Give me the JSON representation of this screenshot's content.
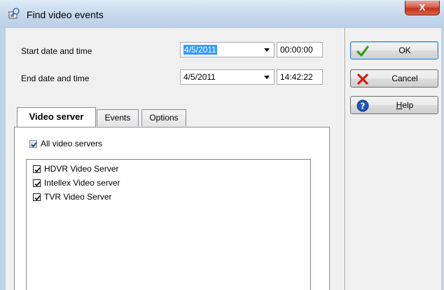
{
  "window": {
    "title": "Find video events",
    "close_symbol": "X"
  },
  "form": {
    "start_label": "Start date and time",
    "start_date": "4/5/2011",
    "start_time": "00:00:00",
    "end_label": "End date and time",
    "end_date": "4/5/2011",
    "end_time": "14:42:22"
  },
  "buttons": {
    "ok": "OK",
    "cancel": "Cancel",
    "help_underlined": "H",
    "help_rest": "elp"
  },
  "tabs": [
    {
      "label": "Video server",
      "active": true
    },
    {
      "label": "Events",
      "active": false
    },
    {
      "label": "Options",
      "active": false
    }
  ],
  "video_server_tab": {
    "all_label": "All video servers",
    "all_checked": true,
    "servers": [
      {
        "label": "HDVR Video Server",
        "checked": true
      },
      {
        "label": "Intellex Video server",
        "checked": true
      },
      {
        "label": "TVR Video Server",
        "checked": true
      }
    ]
  },
  "colors": {
    "selection": "#3399ff",
    "ok_check": "#2a9a14",
    "cancel_x": "#d11b0d",
    "help_blue": "#1f56b8"
  },
  "icons": {
    "title": "find-events-icon",
    "ok": "check-icon",
    "cancel": "x-icon",
    "help": "question-icon"
  }
}
